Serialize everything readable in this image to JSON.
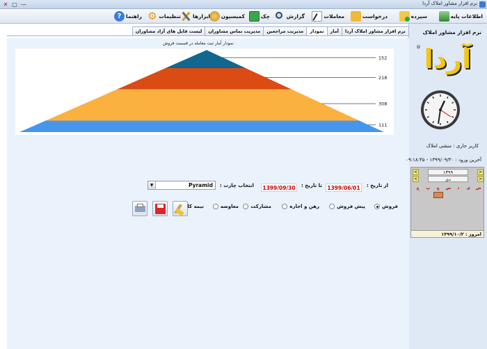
{
  "window": {
    "title": "نرم افزار مشاور املاک آردا",
    "close": "✕",
    "maximize": "▢",
    "minimize": "—"
  },
  "toolbar": [
    {
      "label": "اطلاعات پایه",
      "icon": "base-info-icon"
    },
    {
      "label": "سپرده",
      "icon": "folder-add-icon"
    },
    {
      "label": "درخواست",
      "icon": "folder-icon"
    },
    {
      "label": "معاملات",
      "icon": "contract-pen-icon"
    },
    {
      "label": "گزارش",
      "icon": "magnifier-icon"
    },
    {
      "label": "چک",
      "icon": "check-money-icon"
    },
    {
      "label": "کمیسیون",
      "icon": "coins-icon"
    },
    {
      "label": "ابزارها",
      "icon": "tools-icon"
    },
    {
      "label": "تنظیمات",
      "icon": "gear-icon"
    },
    {
      "label": "راهنما",
      "icon": "help-icon"
    }
  ],
  "tabs": [
    {
      "label": "نرم افزار مشاور املاک آردا",
      "active": false
    },
    {
      "label": "آمار",
      "active": false
    },
    {
      "label": "نمودار",
      "active": true
    },
    {
      "label": "مدیریت مراجعین",
      "active": false
    },
    {
      "label": "مدیریت تماس مشاوران",
      "active": false
    },
    {
      "label": "لیست فایل های آزاد مشاوران",
      "active": false
    }
  ],
  "chart_data": {
    "type": "pyramid",
    "title": "نمودار آمار ثبت معامله در قسمت فروش",
    "series": [
      {
        "value": 152,
        "color": "#12678f"
      },
      {
        "value": 218,
        "color": "#db4b14"
      },
      {
        "value": 308,
        "color": "#fbb140"
      },
      {
        "value": 111,
        "color": "#4696ec"
      }
    ]
  },
  "form": {
    "from_date_label": "از تاریخ :",
    "from_date": "1399/06/01",
    "to_date_label": "تا تاریخ :",
    "to_date": "1399/09/30",
    "chart_type_label": "انتخاب چارت :",
    "chart_type": "Pyramid",
    "chart_type_arrow": "▼"
  },
  "radios": [
    {
      "label": "فروش",
      "selected": true
    },
    {
      "label": "پیش فروش",
      "selected": false
    },
    {
      "label": "رهن و اجاره",
      "selected": false
    },
    {
      "label": "مشارکت",
      "selected": false
    },
    {
      "label": "معاوضه",
      "selected": false
    },
    {
      "label": "نیمه کاره",
      "selected": false
    }
  ],
  "sidebar": {
    "app_title": "نرم افزار مشاور املاک",
    "logo_text": "آردا",
    "registered_mark": "®",
    "current_user": "کاربر جاری : منشی املاک",
    "last_login": "آخرین ورود : ۱۳۹۹/۰۹/۳۰ - ۰۹:۱۸:۴۵"
  },
  "calendar": {
    "year": "۱۳۹۹",
    "month": "دی",
    "prev": "<",
    "next": ">",
    "weekdays": [
      "ش",
      "ی",
      "د",
      "س",
      "چ",
      "پ",
      "ج"
    ],
    "weeks": [
      [
        "",
        "",
        "",
        "",
        "",
        "",
        ""
      ],
      [
        "",
        "",
        "",
        "",
        "",
        "",
        ""
      ],
      [
        "",
        "",
        "",
        "",
        "",
        "",
        ""
      ],
      [
        "",
        "",
        "",
        "",
        "",
        "",
        ""
      ],
      [
        "",
        "",
        "",
        "",
        "",
        "",
        ""
      ],
      [
        "",
        "",
        "",
        "",
        "",
        "",
        ""
      ],
      [
        "",
        "",
        "",
        "",
        "",
        "",
        ""
      ]
    ],
    "today_label": "امروز : ۱۳۹۹/۱۰/۲"
  }
}
